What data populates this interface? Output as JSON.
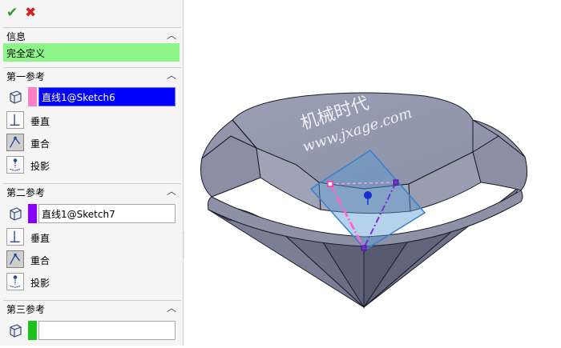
{
  "confirm": {
    "ok_icon": "checkmark-icon",
    "cancel_icon": "close-icon"
  },
  "info": {
    "title": "信息",
    "status": "完全定义",
    "status_color": "#8ef58a"
  },
  "refs": [
    {
      "title": "第一参考",
      "entity": "直线1@Sketch6",
      "swatch_color": "#ff7fc4",
      "selected": true,
      "options": [
        "垂直",
        "重合",
        "投影"
      ],
      "active_option": "重合"
    },
    {
      "title": "第二参考",
      "entity": "直线1@Sketch7",
      "swatch_color": "#8a00ff",
      "selected": false,
      "options": [
        "垂直",
        "重合",
        "投影"
      ],
      "active_option": "重合"
    },
    {
      "title": "第三参考",
      "entity": "",
      "swatch_color": "#1ec21e",
      "selected": false
    }
  ],
  "viewport": {
    "watermark_text_1": "机械时代",
    "watermark_text_2": "www.jxage.com",
    "plane_color": "#5b9bd5",
    "line1_color": "#ff66cc",
    "line2_color": "#7a2fd6"
  }
}
